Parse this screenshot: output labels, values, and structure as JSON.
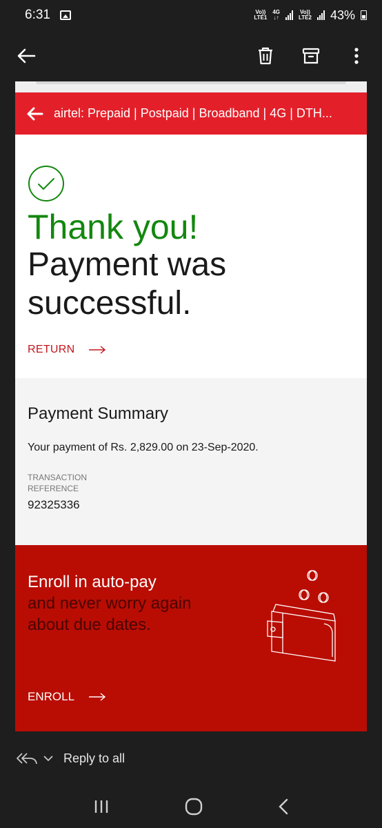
{
  "status_bar": {
    "time": "6:31",
    "sim1_top": "Vo))",
    "sim1_mid": "4G",
    "sim1_bottom": "LTE1",
    "sim2_top": "Vo))",
    "sim2_bottom": "LTE2",
    "battery": "43%"
  },
  "app_bar": {
    "icons": [
      "back-arrow-icon",
      "delete-icon",
      "archive-icon",
      "more-vert-icon"
    ]
  },
  "email": {
    "header_title": "airtel: Prepaid | Postpaid | Broadband | 4G | DTH...",
    "thanks_title": "Thank you!",
    "thanks_line1": "Payment was",
    "thanks_line2": "successful.",
    "return_label": "RETURN",
    "summary": {
      "title": "Payment Summary",
      "text": "Your payment of Rs. 2,829.00 on 23-Sep-2020.",
      "txn_label": "TRANSACTION REFERENCE",
      "txn_value": "92325336"
    },
    "autopay": {
      "line1": "Enroll in auto-pay",
      "line2": "and never worry again",
      "line3": "about due dates.",
      "enroll_label": "ENROLL"
    }
  },
  "reply_bar": {
    "label": "Reply to all"
  },
  "colors": {
    "airtel_red": "#e3202a",
    "success_green": "#13870f",
    "autopay_red": "#b90d04",
    "link_red": "#c3161c"
  }
}
